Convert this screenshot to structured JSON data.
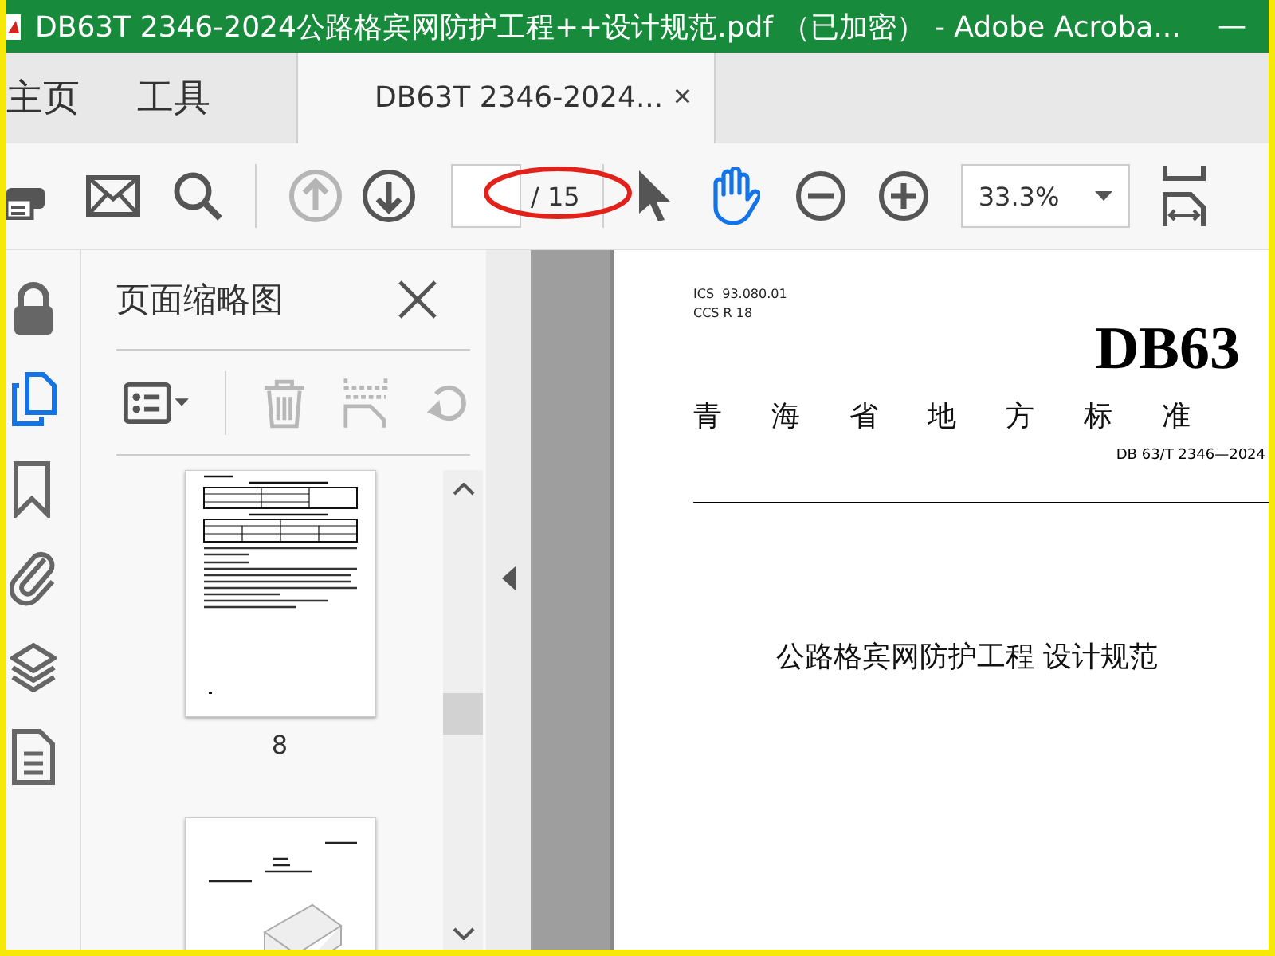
{
  "window": {
    "title": "DB63T 2346-2024公路格宾网防护工程++设计规范.pdf （已加密） - Adobe Acroba...",
    "minimize": "—"
  },
  "tabs": [
    {
      "label": "主页",
      "selected": false
    },
    {
      "label": "工具",
      "selected": false
    },
    {
      "label": "DB63T 2346-2024...",
      "selected": true,
      "close": "×"
    }
  ],
  "toolbar": {
    "nav": [
      {
        "kind": "prev",
        "disabled": true
      },
      {
        "kind": "next",
        "disabled": false
      }
    ],
    "page_total": "/ 15",
    "tools": [
      {
        "kind": "select",
        "selected": false
      },
      {
        "kind": "hand",
        "selected": true
      }
    ],
    "zoom": "33.3%"
  },
  "rail": [
    {
      "kind": "lock",
      "selected": false
    },
    {
      "kind": "pages",
      "selected": true
    },
    {
      "kind": "bookmark",
      "selected": false
    },
    {
      "kind": "attachment",
      "selected": false
    },
    {
      "kind": "layers",
      "selected": false
    },
    {
      "kind": "document",
      "selected": false
    }
  ],
  "sidebar": {
    "title": "页面缩略图",
    "tools": [
      {
        "kind": "options",
        "disabled": false
      },
      {
        "kind": "delete",
        "disabled": true
      },
      {
        "kind": "extract",
        "disabled": true
      },
      {
        "kind": "rotate",
        "disabled": true
      }
    ],
    "thumbnails": [
      {
        "kind": "tables",
        "label": "8"
      },
      {
        "kind": "figure"
      }
    ]
  },
  "document": {
    "ics_label": "ICS",
    "ics_code": "93.080.01",
    "ccs_label": "CCS",
    "ccs_code": "R 18",
    "code": "DB63",
    "region": "青海省地方标准",
    "number": "DB 63/T 2346—2024",
    "title": "公路格宾网防护工程 设计规范"
  }
}
